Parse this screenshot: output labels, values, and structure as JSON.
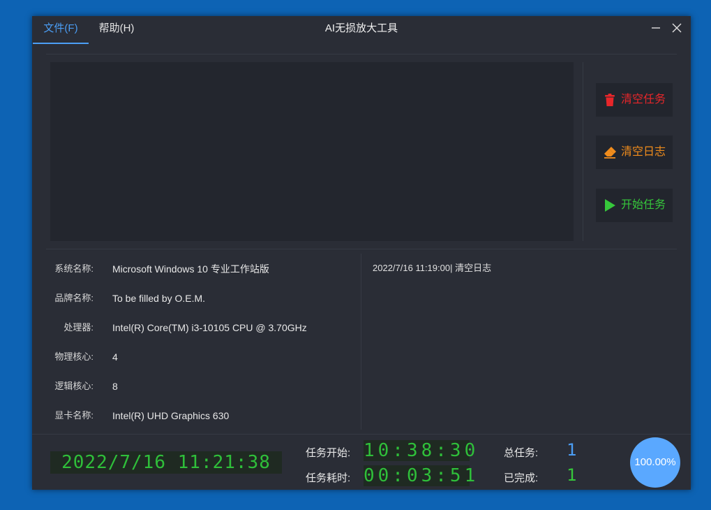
{
  "menu": {
    "file": "文件(F)",
    "help": "帮助(H)"
  },
  "window": {
    "title": "AI无损放大工具"
  },
  "actions": {
    "clear_tasks": "清空任务",
    "clear_log": "清空日志",
    "start_tasks": "开始任务"
  },
  "system_info": [
    {
      "label": "系统名称:",
      "value": "Microsoft Windows 10 专业工作站版"
    },
    {
      "label": "品牌名称:",
      "value": "To be filled by O.E.M."
    },
    {
      "label": "处理器:",
      "value": "Intel(R) Core(TM) i3-10105 CPU @ 3.70GHz"
    },
    {
      "label": "物理核心:",
      "value": "4"
    },
    {
      "label": "逻辑核心:",
      "value": "8"
    },
    {
      "label": "显卡名称:",
      "value": "Intel(R) UHD Graphics 630"
    }
  ],
  "log": {
    "entry": "2022/7/16 11:19:00| 清空日志"
  },
  "status": {
    "datetime": "2022/7/16 11:21:38",
    "task_start_label": "任务开始:",
    "task_start_value": "10:38:30",
    "task_elapsed_label": "任务耗时:",
    "task_elapsed_value": "00:03:51",
    "total_tasks_label": "总任务:",
    "total_tasks_value": "1",
    "completed_label": "已完成:",
    "completed_value": "1",
    "progress": "100.00%"
  },
  "icons": {
    "minimize": "minimize-icon",
    "close": "close-icon",
    "trash": "trash-icon",
    "eraser": "eraser-icon",
    "play": "play-icon"
  },
  "colors": {
    "accent": "#4b9ef5",
    "danger": "#e8262a",
    "warning": "#f08c1c",
    "success": "#36c73b"
  }
}
